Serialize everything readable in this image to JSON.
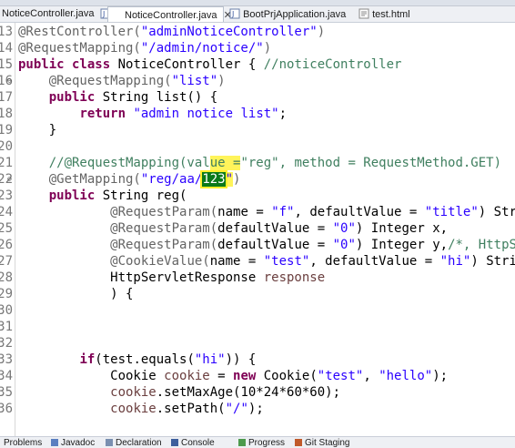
{
  "tabs": [
    {
      "label": "NoticeController.java",
      "icon": "java-file-icon",
      "active": false
    },
    {
      "label": "NoticeController.java",
      "icon": "java-file-icon",
      "active": true,
      "close": "✕"
    },
    {
      "label": "BootPrjApplication.java",
      "icon": "java-file-icon",
      "active": false
    },
    {
      "label": "test.html",
      "icon": "html-file-icon",
      "active": false
    }
  ],
  "editor": {
    "lines": [
      {
        "n": "13",
        "t": "@RestController(\"adminNoticeController\")"
      },
      {
        "n": "14",
        "t": "@RequestMapping(\"/admin/notice/\")"
      },
      {
        "n": "15",
        "t": "public class NoticeController { //noticeController"
      },
      {
        "n": "16",
        "t": "    @RequestMapping(\"list\")"
      },
      {
        "n": "17",
        "t": "    public String list() {"
      },
      {
        "n": "18",
        "t": "        return \"admin notice list\";"
      },
      {
        "n": "19",
        "t": "    }"
      },
      {
        "n": "20",
        "t": ""
      },
      {
        "n": "21",
        "t": "    //@RequestMapping(value =\"reg\", method = RequestMethod.GET)"
      },
      {
        "n": "22",
        "t": "    @GetMapping(\"reg/aa/123\")"
      },
      {
        "n": "23",
        "t": "    public String reg("
      },
      {
        "n": "24",
        "t": "            @RequestParam(name = \"f\", defaultValue = \"title\") Strin"
      },
      {
        "n": "25",
        "t": "            @RequestParam(defaultValue = \"0\") Integer x,"
      },
      {
        "n": "26",
        "t": "            @RequestParam(defaultValue = \"0\") Integer y,/*, HttpSer"
      },
      {
        "n": "27",
        "t": "            @CookieValue(name = \"test\", defaultValue = \"hi\") String"
      },
      {
        "n": "28",
        "t": "            HttpServletResponse response"
      },
      {
        "n": "29",
        "t": "            ) {"
      },
      {
        "n": "30",
        "t": ""
      },
      {
        "n": "31",
        "t": ""
      },
      {
        "n": "32",
        "t": ""
      },
      {
        "n": "33",
        "t": "        if(test.equals(\"hi\")) {"
      },
      {
        "n": "34",
        "t": "            Cookie cookie = new Cookie(\"test\", \"hello\");"
      },
      {
        "n": "35",
        "t": "            cookie.setMaxAge(10*24*60*60);"
      },
      {
        "n": "36",
        "t": "            cookie.setPath(\"/\");"
      }
    ]
  },
  "bottom_tabs": [
    {
      "label": "Problems",
      "icon": "problems-icon"
    },
    {
      "label": "Javadoc",
      "icon": "javadoc-icon"
    },
    {
      "label": "Declaration",
      "icon": "declaration-icon"
    },
    {
      "label": "Console",
      "icon": "console-icon"
    },
    {
      "label": "Progress",
      "icon": "progress-icon"
    },
    {
      "label": "Git Staging",
      "icon": "git-staging-icon"
    }
  ],
  "colors": {
    "keyword": "#7f0055",
    "string": "#2a00ff",
    "comment": "#3f7f5f",
    "annotation": "#646464",
    "highlight": "#0a7a1a",
    "marker": "#fff45a"
  }
}
